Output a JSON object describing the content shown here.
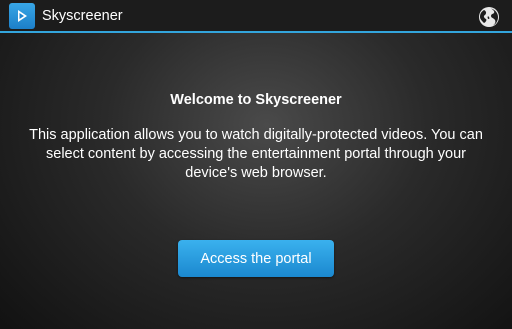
{
  "app": {
    "title": "Skyscreener",
    "icon": "play-icon",
    "action_icon": "globe-icon"
  },
  "main": {
    "heading": "Welcome to Skyscreener",
    "description": "This application allows you to watch digitally-protected videos. You can select content by accessing the entertainment portal through your device's web browser.",
    "button_label": "Access the portal"
  },
  "colors": {
    "accent": "#33a5dc",
    "button": "#2a9fe0",
    "action_bar": "#1c1c1c"
  }
}
